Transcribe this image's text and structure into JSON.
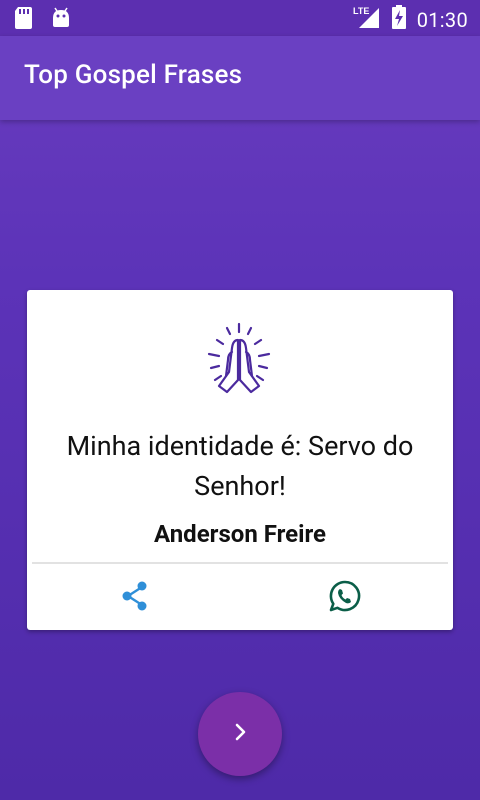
{
  "status_bar": {
    "network": "LTE",
    "time": "01:30",
    "icons": [
      "sd-card-icon",
      "android-icon",
      "lte-signal-icon",
      "battery-charging-icon"
    ]
  },
  "app_bar": {
    "title": "Top Gospel Frases"
  },
  "card": {
    "icon": "praying-hands-icon",
    "quote": "Minha identidade é: Servo do Senhor!",
    "author": "Anderson Freire",
    "actions": [
      {
        "icon": "share-icon",
        "color": "#2f8fd8"
      },
      {
        "icon": "whatsapp-icon",
        "color": "#0b5e48"
      }
    ]
  },
  "fab": {
    "icon": "chevron-right-icon",
    "color": "#7b2fa8"
  },
  "colors": {
    "background": "#5c33b8",
    "app_bar": "#6a40c2",
    "status_bar": "#5c2fb0",
    "icon_purple": "#4b2a9e"
  }
}
